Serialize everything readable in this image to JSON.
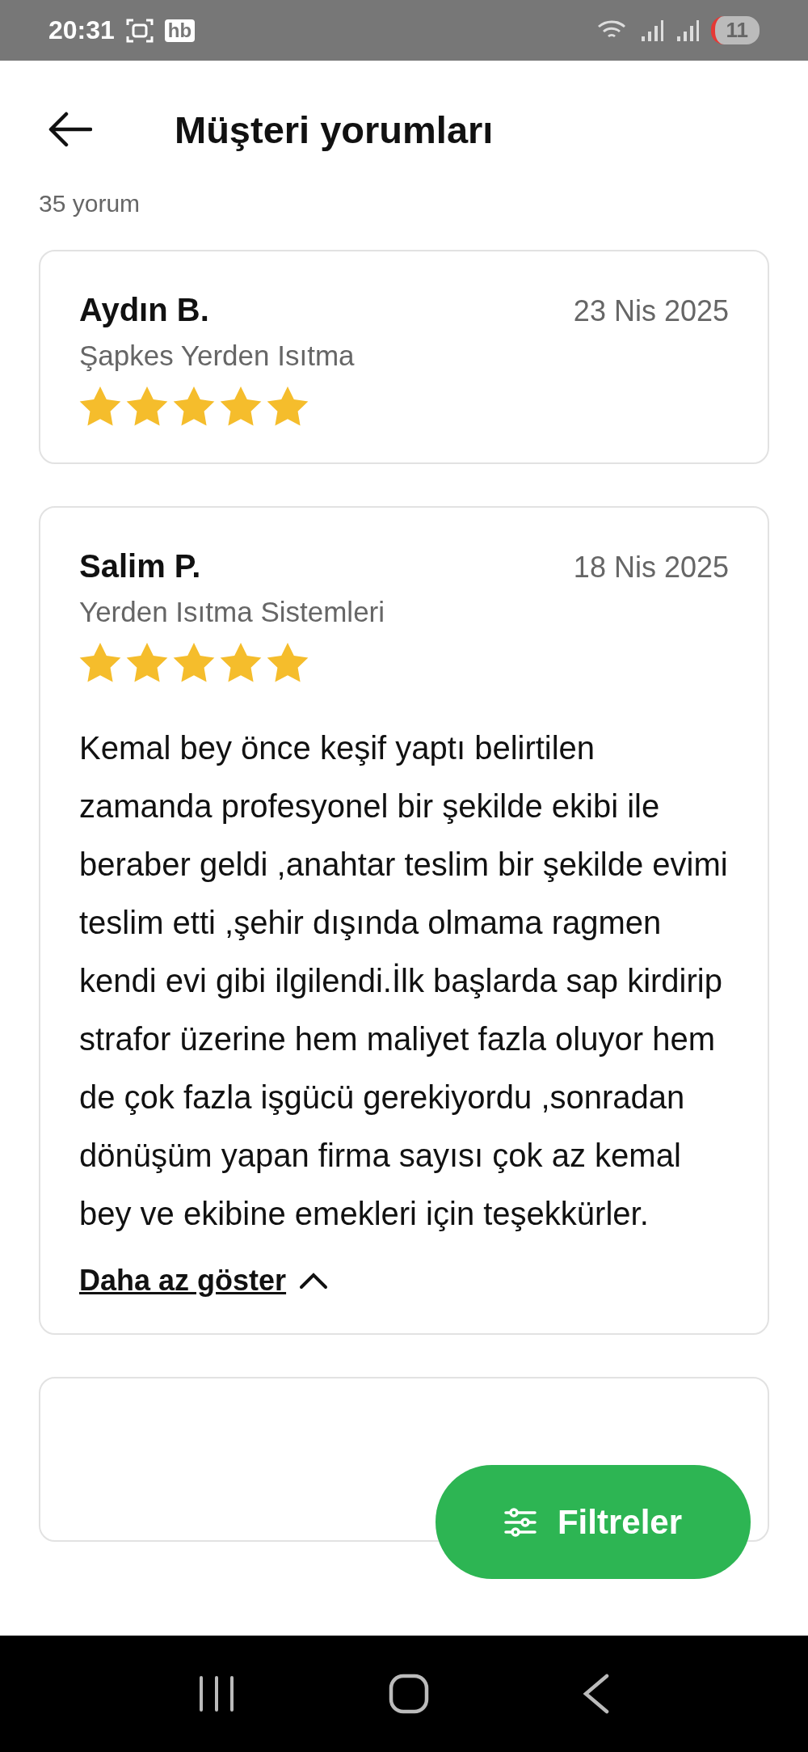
{
  "status_bar": {
    "time": "20:31",
    "app_badge": "hb",
    "battery": "11"
  },
  "header": {
    "title": "Müşteri yorumları"
  },
  "review_count": "35 yorum",
  "reviews": [
    {
      "author": "Aydın B.",
      "date": "23 Nis 2025",
      "service": "Şapkes Yerden Isıtma",
      "stars": 5
    },
    {
      "author": "Salim P.",
      "date": "18 Nis 2025",
      "service": "Yerden Isıtma Sistemleri",
      "stars": 5,
      "text": "Kemal bey önce keşif yaptı belirtilen zamanda profesyonel bir şekilde ekibi ile beraber geldi ,anahtar teslim bir şekilde evimi teslim etti ,şehir dışında olmama ragmen kendi evi gibi ilgilendi.İlk başlarda sap kirdirip strafor üzerine hem maliyet fazla oluyor hem de çok fazla işgücü gerekiyordu ,sonradan dönüşüm yapan firma sayısı çok az  kemal bey ve ekibine emekleri için teşekkürler.",
      "toggle": "Daha az göster",
      "expanded": true
    }
  ],
  "filter_button": {
    "label": "Filtreler"
  }
}
